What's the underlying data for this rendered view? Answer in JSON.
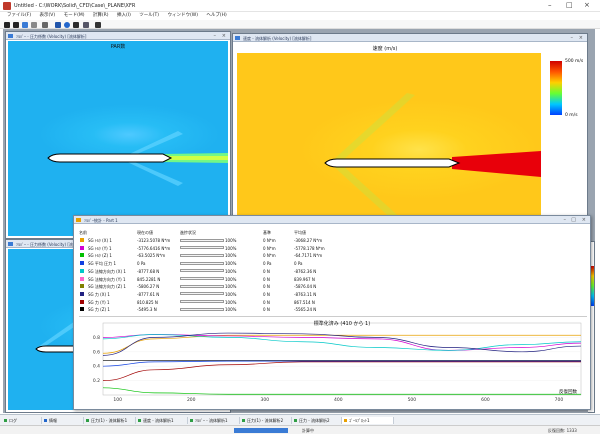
{
  "window": {
    "title": "Untitled - C:\\WORK\\Solid\\_CFD\\Case\\_PLANE\\XFR",
    "minimize": "–",
    "maximize": "□",
    "close": "×"
  },
  "menu": [
    "ファイル(F)",
    "表示(V)",
    "モード(M)",
    "計算(R)",
    "挿入(I)",
    "ツール(T)",
    "ウィンドウ(W)",
    "ヘルプ(H)"
  ],
  "windows": {
    "top_left": {
      "caption": "ｿﾙﾊﾞｰ - 圧力係数 (Velocity) [流体解析]",
      "plot_title": "PAR数"
    },
    "top_right": {
      "caption": "速度 - 流体解析 (Velocity) [流体解析]",
      "plot_title": "速度 (m/s)",
      "legend_max": "500 m/s",
      "legend_min": "0 m/s"
    },
    "bottom_left": {
      "caption": "ｿﾙﾊﾞｰ - 圧力係数 (Velocity) [流体解析]"
    }
  },
  "stat": {
    "caption": "ｿﾙﾊﾞｰ統計 - Part 1",
    "headers": [
      "名前",
      "現在の値",
      "進捗状況",
      "基準",
      "平均値"
    ],
    "rows": [
      {
        "color": "#e8a000",
        "name": "SG ﾄﾙｸ (X) 1",
        "value": "-3123.5078 N*m",
        "pct": "100%",
        "crit": "0 N*m",
        "avg": "-3068.27 N*m"
      },
      {
        "color": "#d100d1",
        "name": "SG ﾄﾙｸ (Y) 1",
        "value": "-5776.6416 N*m",
        "pct": "100%",
        "crit": "0 N*m",
        "avg": "-5778.178 N*m"
      },
      {
        "color": "#00c000",
        "name": "SG ﾄﾙｸ (Z) 1",
        "value": "-63.5025 N*m",
        "pct": "100%",
        "crit": "0 N*m",
        "avg": "-64.7171 N*m"
      },
      {
        "color": "#1040e0",
        "name": "SG 平均 圧力 1",
        "value": "0 Pa",
        "pct": "100%",
        "crit": "0 Pa",
        "avg": "0 Pa"
      },
      {
        "color": "#00c8c8",
        "name": "SG 法線方向力 (X) 1",
        "value": "-8777.68 N",
        "pct": "100%",
        "crit": "0 N",
        "avg": "-8762.36 N"
      },
      {
        "color": "#ff66cc",
        "name": "SG 法線方向力 (Y) 1",
        "value": "845.2281 N",
        "pct": "100%",
        "crit": "0 N",
        "avg": "839.967 N"
      },
      {
        "color": "#808000",
        "name": "SG 法線方向力 (Z) 1",
        "value": "-5806.27 N",
        "pct": "100%",
        "crit": "0 N",
        "avg": "-5876.04 N"
      },
      {
        "color": "#202080",
        "name": "SG 力 (X) 1",
        "value": "-8777.61 N",
        "pct": "100%",
        "crit": "0 N",
        "avg": "-8763.11 N"
      },
      {
        "color": "#a00000",
        "name": "SG 力 (Y) 1",
        "value": "810.825 N",
        "pct": "100%",
        "crit": "0 N",
        "avg": "867.514 N"
      },
      {
        "color": "#000000",
        "name": "SG 力 (Z) 1",
        "value": "-5495.3 N",
        "pct": "100%",
        "crit": "0 N",
        "avg": "-5565.24 N"
      }
    ],
    "graph_title": "標準化済み (410 から 1)",
    "x_label": "反復回数",
    "y_ticks": [
      "0.8",
      "0.6",
      "0.4",
      "0.2"
    ],
    "x_ticks": [
      "100",
      "200",
      "300",
      "400",
      "500",
      "600",
      "700"
    ]
  },
  "chart_data": {
    "type": "line",
    "title": "標準化済み (410 から 1)",
    "xlabel": "反復回数",
    "ylabel": "",
    "xlim": [
      80,
      730
    ],
    "ylim": [
      0,
      1
    ],
    "series": [
      {
        "name": "SG ﾄﾙｸ (X) 1",
        "color": "#e8a000",
        "x": [
          80,
          150,
          250,
          350,
          450,
          550,
          650,
          730
        ],
        "y": [
          0.58,
          0.78,
          0.83,
          0.83,
          0.83,
          0.83,
          0.83,
          0.83
        ]
      },
      {
        "name": "SG ﾄﾙｸ (Y) 1",
        "color": "#d100d1",
        "x": [
          80,
          150,
          250,
          350,
          450,
          550,
          650,
          730
        ],
        "y": [
          0.8,
          0.84,
          0.82,
          0.8,
          0.78,
          0.62,
          0.66,
          0.72
        ]
      },
      {
        "name": "SG ﾄﾙｸ (Z) 1",
        "color": "#00c000",
        "x": [
          80,
          150,
          250,
          350,
          450,
          550,
          650,
          730
        ],
        "y": [
          0.1,
          0.03,
          0.01,
          0.01,
          0.01,
          0.01,
          0.01,
          0.01
        ]
      },
      {
        "name": "SG 法線方向力 (X) 1",
        "color": "#00c8c8",
        "x": [
          80,
          150,
          250,
          350,
          450,
          550,
          650,
          730
        ],
        "y": [
          0.78,
          0.84,
          0.8,
          0.74,
          0.66,
          0.62,
          0.7,
          0.74
        ]
      },
      {
        "name": "SG 力 (X) 1",
        "color": "#202080",
        "x": [
          80,
          150,
          250,
          350,
          450,
          550,
          650,
          730
        ],
        "y": [
          0.55,
          0.8,
          0.86,
          0.85,
          0.8,
          0.66,
          0.6,
          0.68
        ]
      },
      {
        "name": "SG 力 (Z) 1",
        "color": "#000000",
        "x": [
          80,
          150,
          250,
          350,
          450,
          550,
          650,
          730
        ],
        "y": [
          0.48,
          0.48,
          0.48,
          0.48,
          0.48,
          0.48,
          0.48,
          0.48
        ]
      },
      {
        "name": "SG 平均 圧力 1",
        "color": "#1040e0",
        "x": [
          80,
          150,
          250,
          350,
          450,
          550,
          650,
          730
        ],
        "y": [
          0.4,
          0.46,
          0.47,
          0.47,
          0.47,
          0.47,
          0.47,
          0.47
        ]
      },
      {
        "name": "SG 力 (Y) 1",
        "color": "#a00000",
        "x": [
          80,
          150,
          250,
          350,
          450,
          550,
          650,
          730
        ],
        "y": [
          0.2,
          0.35,
          0.42,
          0.46,
          0.46,
          0.46,
          0.46,
          0.46
        ]
      }
    ]
  },
  "taskbar": [
    "ログ",
    "情報",
    "圧力(1) - 流体解析1",
    "速度 - 流体解析1",
    "ｿﾙﾊﾞｰ - 流体解析1",
    "圧力(1) - 流体解析2",
    "圧力 - 流体解析2",
    "ｺﾞｰﾙﾌﾟﾛｯﾄ1"
  ],
  "status": {
    "left": "計算中",
    "mid": "反復回数: 1333"
  }
}
